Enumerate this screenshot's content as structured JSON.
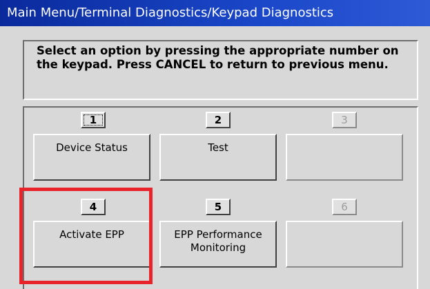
{
  "window": {
    "title": "Main Menu/Terminal Diagnostics/Keypad Diagnostics"
  },
  "instructions": {
    "line1": "Select an option by pressing the appropriate number on",
    "line2": "the keypad.  Press CANCEL to return to previous menu."
  },
  "options": [
    {
      "key": "1",
      "label": "Device Status",
      "enabled": true,
      "focused": true
    },
    {
      "key": "2",
      "label": "Test",
      "enabled": true,
      "focused": false
    },
    {
      "key": "3",
      "label": "",
      "enabled": false,
      "focused": false
    },
    {
      "key": "4",
      "label": "Activate EPP",
      "enabled": true,
      "focused": false,
      "highlighted": true
    },
    {
      "key": "5",
      "label_line1": "EPP Performance",
      "label_line2": "Monitoring",
      "enabled": true,
      "focused": false
    },
    {
      "key": "6",
      "label": "",
      "enabled": false,
      "focused": false
    }
  ],
  "colors": {
    "title_bar": "#0a2a9c",
    "background": "#d8d8d8",
    "highlight": "#e8242a",
    "disabled_text": "#9c9c9c"
  }
}
